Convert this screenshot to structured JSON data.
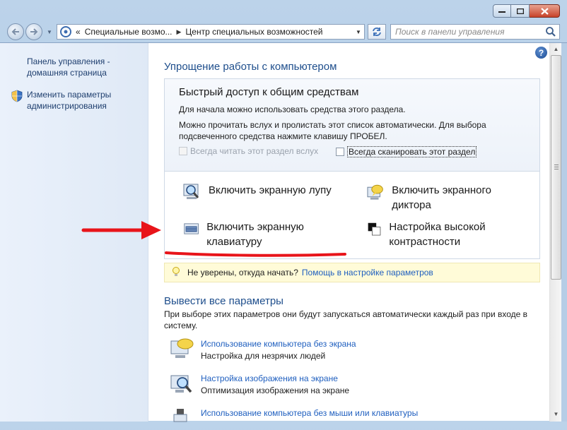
{
  "window": {
    "controls": {
      "minimize": "minimize-icon",
      "maximize": "maximize-icon",
      "close": "close-icon"
    }
  },
  "nav": {
    "breadcrumb_prefix": "«",
    "crumbs": [
      "Специальные возмо...",
      "Центр специальных возможностей"
    ],
    "search_placeholder": "Поиск в панели управления"
  },
  "sidebar": {
    "home_link": "Панель управления - домашняя страница",
    "admin_link": "Изменить параметры администрирования"
  },
  "main": {
    "heading": "Упрощение работы с компьютером",
    "quick_access": {
      "title": "Быстрый доступ к общим средствам",
      "line1": "Для начала можно использовать средства этого раздела.",
      "line2": "Можно прочитать вслух и пролистать этот список автоматически. Для выбора подсвеченного средства нажмите клавишу ПРОБЕЛ.",
      "check_read": "Всегда читать этот раздел вслух",
      "check_scan": "Всегда сканировать этот раздел"
    },
    "tools": {
      "magnifier": "Включить экранную лупу",
      "narrator": "Включить экранного диктора",
      "keyboard": "Включить экранную клавиатуру",
      "contrast": "Настройка высокой контрастности"
    },
    "tip": {
      "text": "Не уверены, откуда начать?",
      "link": "Помощь в настройке параметров"
    },
    "all_settings": {
      "heading": "Вывести все параметры",
      "description": "При выборе этих параметров они будут запускаться автоматически каждый раз при входе в систему.",
      "options": [
        {
          "link": "Использование компьютера без экрана",
          "desc": "Настройка для незрячих людей"
        },
        {
          "link": "Настройка изображения на экране",
          "desc": "Оптимизация изображения на экране"
        },
        {
          "link": "Использование компьютера без мыши или клавиатуры",
          "desc": ""
        }
      ]
    }
  },
  "help_label": "?",
  "accent_colors": {
    "link": "#1f5fbf",
    "heading": "#1e4e8c",
    "annotation": "#e8141a"
  }
}
